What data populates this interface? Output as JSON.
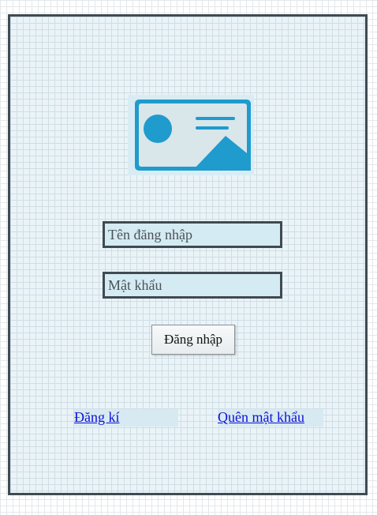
{
  "login_form": {
    "logo_icon": "image-placeholder-icon",
    "username": {
      "value": "",
      "placeholder": "Tên đăng nhập"
    },
    "password": {
      "value": "",
      "placeholder": "Mật khẩu"
    },
    "login_button_label": "Đăng nhập",
    "register_link_label": "Đăng kí",
    "forgot_password_link_label": "Quên mật khẩu"
  },
  "colors": {
    "frame_border": "#3f4a52",
    "frame_background": "#eaf4f8",
    "field_background": "#d4ebf3",
    "logo_blue": "#1f9bcd",
    "link_color": "#1010d8"
  }
}
